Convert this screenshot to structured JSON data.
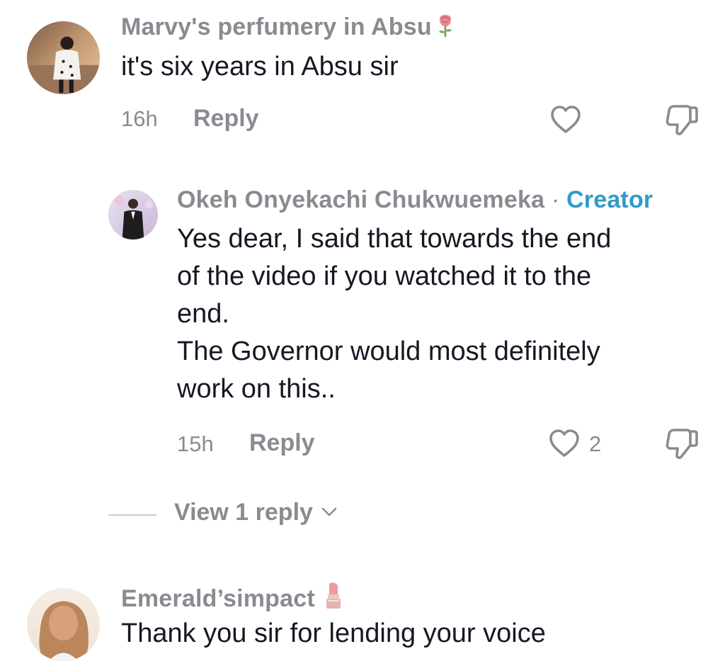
{
  "comments": [
    {
      "username": "Marvy's perfumery in Absu",
      "text": "it's six years in Absu sir",
      "time": "16h",
      "reply_label": "Reply",
      "likes": ""
    },
    {
      "username": "Okeh Onyekachi Chukwuemeka",
      "creator_sep": "·",
      "creator_label": "Creator",
      "text": "Yes dear, I said that towards the end\nof the video if you watched it to the\nend.\nThe Governor would most definitely\nwork on this..",
      "time": "15h",
      "reply_label": "Reply",
      "likes": "2"
    },
    {
      "username": "Emerald’simpact",
      "text": "Thank you sir for lending your voice"
    }
  ],
  "view_replies": {
    "label": "View 1 reply"
  },
  "colors": {
    "username": "#8a8b91",
    "text": "#161823",
    "creator": "#2f9bc9",
    "divider": "#c9cacd"
  },
  "icons": {
    "like": "heart-outline-icon",
    "dislike": "thumbs-down-icon",
    "expand": "chevron-down-icon",
    "rose": "rose-emoji",
    "lipstick": "lipstick-emoji"
  }
}
